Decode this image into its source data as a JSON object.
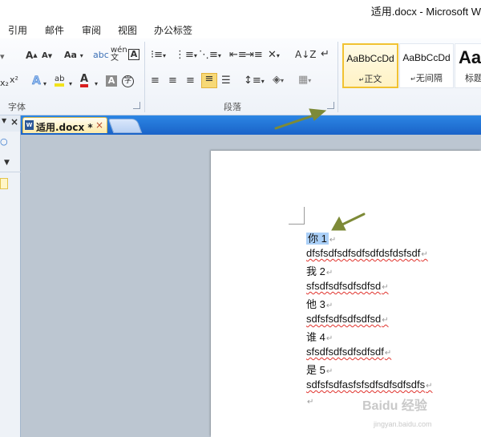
{
  "window": {
    "title": "适用.docx - Microsoft W"
  },
  "menu": {
    "items": [
      "引用",
      "邮件",
      "审阅",
      "视图",
      "办公标签"
    ]
  },
  "ribbon": {
    "groups": {
      "font": "字体",
      "paragraph": "段落"
    },
    "font_buttons": {
      "grow": "A",
      "shrink": "A",
      "case": "Aa",
      "clear": "A",
      "text_effect": "A",
      "highlight": "ab",
      "font_color": "A",
      "char_shade": "A",
      "enclose": "字"
    },
    "styles": [
      {
        "sample": "AaBbCcDd",
        "name": "正文",
        "selected": true
      },
      {
        "sample": "AaBbCcDd",
        "name": "无间隔",
        "selected": false
      },
      {
        "sample": "Aa",
        "name": "标题",
        "selected": false
      }
    ]
  },
  "tabs": {
    "doc_tab": {
      "label": "适用.docx *",
      "close": "×"
    }
  },
  "left_panel": {
    "close": "×"
  },
  "document": {
    "lines": [
      {
        "text": "你 1",
        "mark": "↵",
        "selected": true
      },
      {
        "text": "dfsfsdfsdfsdfsdfdsfdsfsdf",
        "mark": "↵",
        "spell": true
      },
      {
        "text": "我 2",
        "mark": "↵"
      },
      {
        "text": "sfsdfsdfsdfsdfsd",
        "mark": "↵",
        "spell": true
      },
      {
        "text": "他 3",
        "mark": "↵"
      },
      {
        "text": "sdfsfsdfsdfsdfsd",
        "mark": "↵",
        "spell": true
      },
      {
        "text": "谁 4",
        "mark": "↵"
      },
      {
        "text": "sfsdfsdfsdfsdfsdf",
        "mark": "↵",
        "spell": true
      },
      {
        "text": "是 5",
        "mark": "↵"
      },
      {
        "text": "sdfsfsdfasfsfsdfsdfsdfsdfs",
        "mark": "↵",
        "spell": true
      },
      {
        "text": "",
        "mark": "↵"
      }
    ]
  },
  "watermark": {
    "brand": "Baidu 经验",
    "url": "jingyan.baidu.com"
  },
  "colors": {
    "accent_blue": "#1a63c8",
    "selection": "#aacff7",
    "arrow": "#7d8a37",
    "spell": "#e0322c"
  }
}
